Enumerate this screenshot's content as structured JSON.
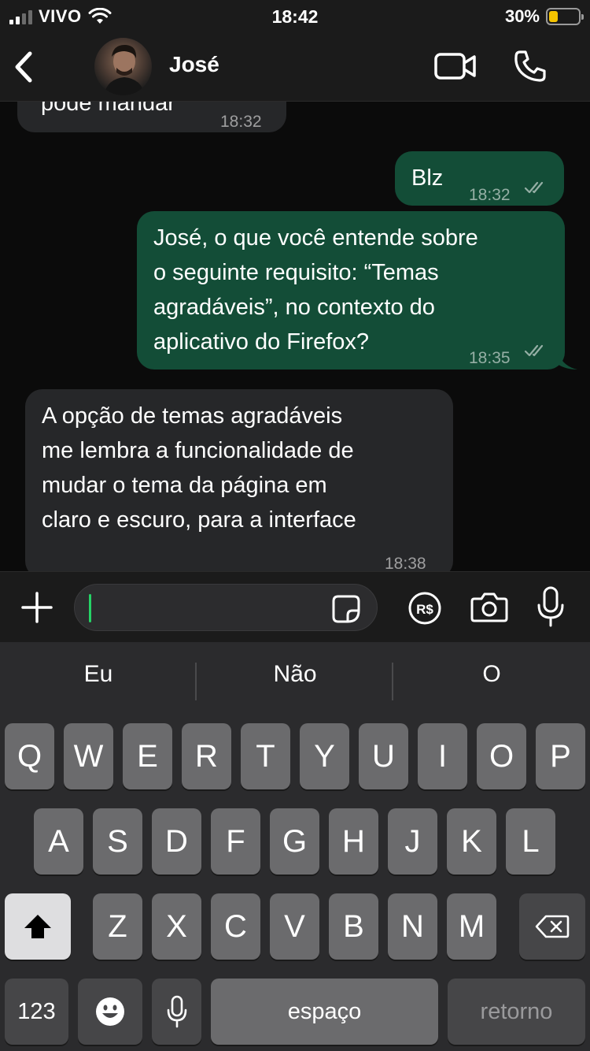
{
  "status": {
    "carrier": "VIVO",
    "time": "18:42",
    "battery_pct": "30%",
    "battery_level": 0.3
  },
  "header": {
    "contact_name": "José"
  },
  "messages": [
    {
      "text": "pode mandar",
      "time": "18:32",
      "direction": "in"
    },
    {
      "text": "Blz",
      "time": "18:32",
      "direction": "out"
    },
    {
      "lines": [
        "José, o que você entende sobre",
        "o seguinte requisito: “Temas",
        "agradáveis”, no contexto do",
        "aplicativo do Firefox?"
      ],
      "time": "18:35",
      "direction": "out"
    },
    {
      "lines": [
        "A opção de temas agradáveis",
        "me lembra a funcionalidade de",
        "mudar o tema da página em",
        "claro e escuro, para a interface"
      ],
      "time": "18:38",
      "direction": "in"
    }
  ],
  "input": {
    "value": ""
  },
  "keyboard": {
    "suggestions": [
      "Eu",
      "Não",
      "O"
    ],
    "row1": [
      "Q",
      "W",
      "E",
      "R",
      "T",
      "Y",
      "U",
      "I",
      "O",
      "P"
    ],
    "row2": [
      "A",
      "S",
      "D",
      "F",
      "G",
      "H",
      "J",
      "K",
      "L"
    ],
    "row3": [
      "Z",
      "X",
      "C",
      "V",
      "B",
      "N",
      "M"
    ],
    "numbers_label": "123",
    "space_label": "espaço",
    "return_label": "retorno"
  },
  "colors": {
    "outgoing_bubble": "#134d37",
    "incoming_bubble": "#262729",
    "accent": "#25d366",
    "battery": "#f5c400"
  }
}
